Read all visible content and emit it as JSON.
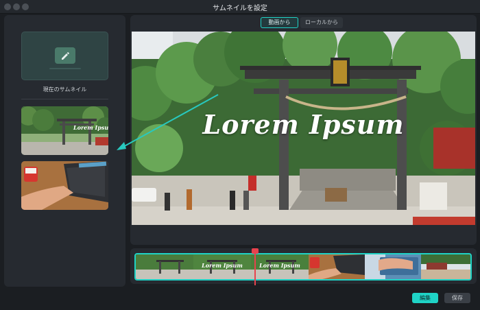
{
  "window": {
    "title": "サムネイルを設定"
  },
  "left_panel": {
    "current_thumbnail_label": "現在のサムネイル"
  },
  "tabs": [
    {
      "label": "動画から",
      "active": true
    },
    {
      "label": "ローカルから",
      "active": false
    }
  ],
  "preview": {
    "overlay_text": "Lorem Ipsum"
  },
  "timeline": {
    "frames": [
      {
        "kind": "torii",
        "text": ""
      },
      {
        "kind": "torii",
        "text": "Lorem Ipsum"
      },
      {
        "kind": "torii",
        "text": "Lorem Ipsum"
      },
      {
        "kind": "laptop",
        "text": ""
      },
      {
        "kind": "hands",
        "text": ""
      },
      {
        "kind": "street",
        "text": ""
      }
    ]
  },
  "buttons": {
    "edit": "編集",
    "save": "保存"
  },
  "colors": {
    "accent": "#1fd3c6",
    "playhead": "#e8424d",
    "background": "#1b1e22",
    "panel": "#262a30"
  },
  "icons": {
    "edit": "pencil-edit-icon"
  }
}
